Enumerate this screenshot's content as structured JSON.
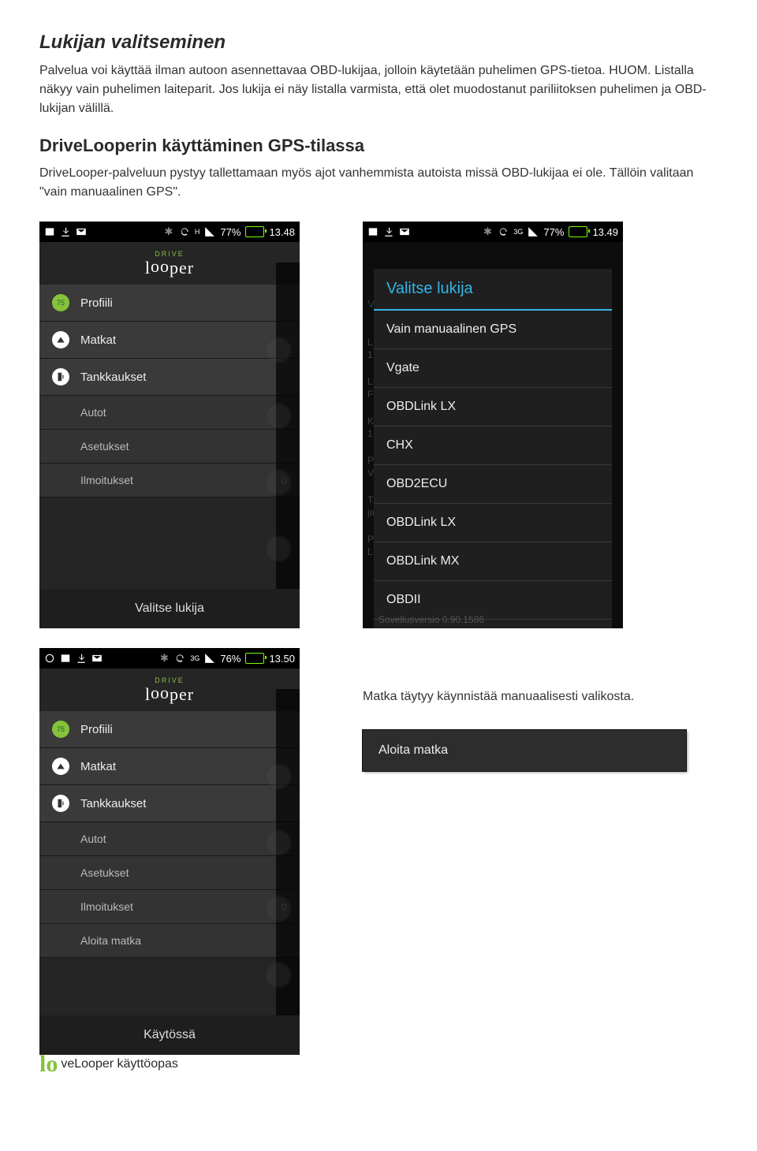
{
  "headings": {
    "h1": "Lukijan valitseminen",
    "h2": "DriveLooperin käyttäminen GPS-tilassa"
  },
  "paragraphs": {
    "p1": "Palvelua voi käyttää ilman autoon asennettavaa OBD-lukijaa, jolloin käytetään puhelimen GPS-tietoa. HUOM. Listalla näkyy vain puhelimen laiteparit. Jos lukija ei näy listalla varmista, että olet muodostanut pariliitoksen puhelimen ja OBD-lukijan välillä.",
    "p2": "DriveLooper-palveluun pystyy tallettamaan myös ajot vanhemmista autoista missä OBD-lukijaa ei ole. Tällöin valitaan \"vain manuaalinen GPS\".",
    "p3": "Matka täytyy käynnistää manuaalisesti valikosta."
  },
  "statusbars": {
    "s1": {
      "battery": "77%",
      "time": "13.48",
      "net": "H"
    },
    "s2": {
      "battery": "77%",
      "time": "13.49",
      "net": "3G"
    },
    "s3": {
      "battery": "76%",
      "time": "13.50",
      "net": "3G"
    }
  },
  "brand": {
    "drive": "DRIVE",
    "looper": "looper"
  },
  "menu1": {
    "items": [
      {
        "label": "Profiili"
      },
      {
        "label": "Matkat"
      },
      {
        "label": "Tankkaukset"
      },
      {
        "label": "Autot"
      },
      {
        "label": "Asetukset"
      },
      {
        "label": "Ilmoitukset",
        "badge": "0"
      }
    ],
    "bottom": "Valitse lukija"
  },
  "dialog": {
    "title": "Valitse lukija",
    "hint_left": "V",
    "options": [
      "Vain manuaalinen GPS",
      "Vgate",
      "OBDLink LX",
      "CHX",
      "OBD2ECU",
      "OBDLink LX",
      "OBDLink MX",
      "OBDII"
    ],
    "bg_labels": [
      "L",
      "1",
      "L",
      "F",
      "K",
      "1",
      "P",
      "V",
      "T",
      "ja",
      "P",
      "L"
    ],
    "version": "Sovellusversio 0.90.1586"
  },
  "menu3": {
    "items": [
      {
        "label": "Profiili"
      },
      {
        "label": "Matkat"
      },
      {
        "label": "Tankkaukset"
      },
      {
        "label": "Autot"
      },
      {
        "label": "Asetukset"
      },
      {
        "label": "Ilmoitukset",
        "badge": "0"
      },
      {
        "label": "Aloita matka"
      }
    ],
    "bottom": "Käytössä"
  },
  "start_button": "Aloita matka",
  "footer": {
    "lo": "lo",
    "text": "veLooper käyttöopas"
  }
}
